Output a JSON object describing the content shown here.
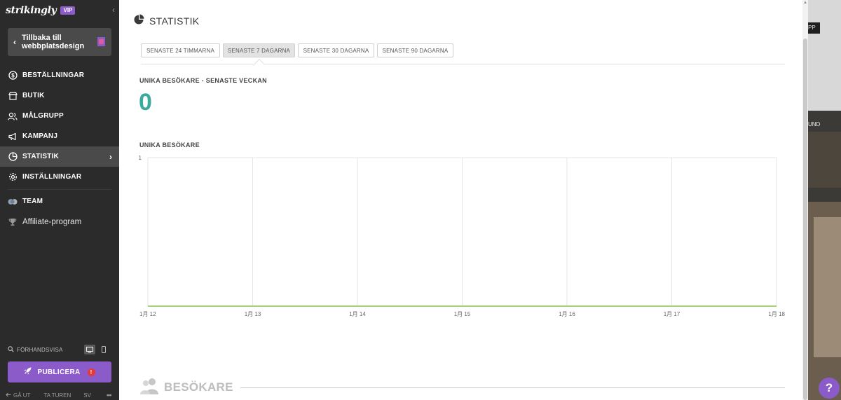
{
  "app": {
    "brand": "strikingly",
    "badge": "VIP"
  },
  "sidebar": {
    "back_label": "Tillbaka till webbplatsdesign",
    "items": [
      {
        "label": "BESTÄLLNINGAR",
        "icon": "dollar-circle-icon"
      },
      {
        "label": "BUTIK",
        "icon": "store-icon"
      },
      {
        "label": "MÅLGRUPP",
        "icon": "audience-icon"
      },
      {
        "label": "KAMPANJ",
        "icon": "megaphone-icon"
      },
      {
        "label": "STATISTIK",
        "icon": "pie-chart-icon",
        "active": true
      },
      {
        "label": "INSTÄLLNINGAR",
        "icon": "gear-icon"
      },
      {
        "label": "TEAM",
        "icon": "team-icon"
      },
      {
        "label": "Affiliate-program",
        "icon": "trophy-icon"
      }
    ],
    "preview_label": "FÖRHANDSVISA",
    "publish_label": "PUBLICERA",
    "publish_alert": "!",
    "footer": {
      "exit": "GÅ UT",
      "tour": "TA TUREN",
      "lang": "SV",
      "more": "•••"
    }
  },
  "main": {
    "title": "STATISTIK",
    "tabs": [
      {
        "label": "SENASTE 24 TIMMARNA",
        "selected": false
      },
      {
        "label": "SENASTE 7 DAGARNA",
        "selected": true
      },
      {
        "label": "SENASTE 30 DAGARNA",
        "selected": false
      },
      {
        "label": "SENASTE 90 DAGARNA",
        "selected": false
      }
    ],
    "unique_week_label": "UNIKA BESÖKARE - SENASTE VECKAN",
    "unique_week_value": "0",
    "chart_title": "UNIKA BESÖKARE",
    "visitors_section": "BESÖKARE"
  },
  "background": {
    "app_fragment": "PP",
    "text_fragment": "UND"
  },
  "help_label": "?",
  "colors": {
    "accent": "#8b5cc9",
    "metric": "#3aaa9c",
    "line": "#8bc34a",
    "sidebar_bg": "#2b2b2b"
  },
  "chart_data": {
    "type": "line",
    "title": "UNIKA BESÖKARE",
    "categories": [
      "1月 12",
      "1月 13",
      "1月 14",
      "1月 15",
      "1月 16",
      "1月 17",
      "1月 18"
    ],
    "series": [
      {
        "values": [
          0,
          0,
          0,
          0,
          0,
          0,
          0
        ]
      }
    ],
    "ylim": [
      0,
      1
    ],
    "yticks": [
      "1"
    ],
    "grid": true
  }
}
